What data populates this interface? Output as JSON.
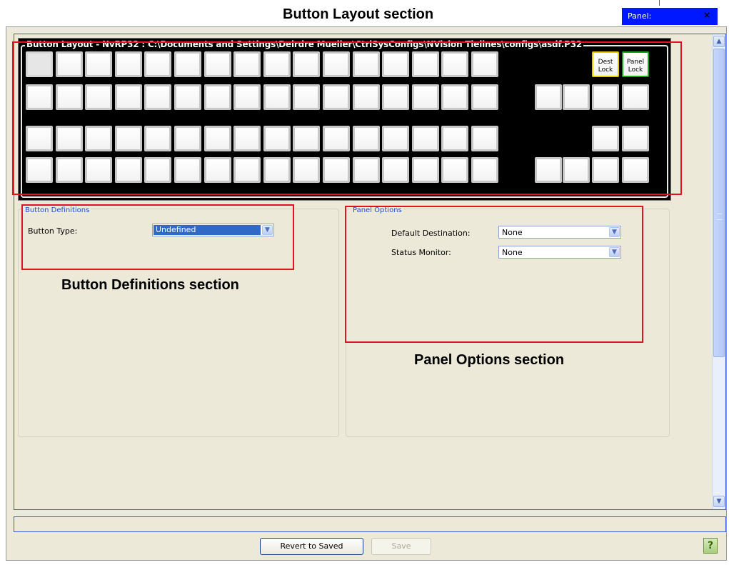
{
  "annotations": {
    "button_layout": "Button Layout section",
    "button_definitions": "Button Definitions section",
    "panel_options": "Panel Options section"
  },
  "panel_tab": {
    "label": "Panel:",
    "close": "×"
  },
  "button_layout": {
    "legend": "Button Layout - NvRP32 : C:\\Documents and Settings\\Deirdre Mueller\\CtrlSysConfigs\\NVision Tielines\\configs\\asdf.P32",
    "dest_lock_line1": "Dest",
    "dest_lock_line2": "Lock",
    "panel_lock_line1": "Panel",
    "panel_lock_line2": "Lock"
  },
  "button_definitions": {
    "legend": "Button Definitions",
    "button_type_label": "Button Type:",
    "button_type_value": "Undefined"
  },
  "panel_options": {
    "legend": "Panel Options",
    "default_destination_label": "Default Destination:",
    "default_destination_value": "None",
    "status_monitor_label": "Status Monitor:",
    "status_monitor_value": "None"
  },
  "footer": {
    "revert_label": "Revert to Saved",
    "save_label": "Save",
    "help_glyph": "?"
  },
  "colors": {
    "annotation_box": "#e0141e",
    "tab_highlight": "#0018ff",
    "legend_text": "#1f4fd0"
  }
}
